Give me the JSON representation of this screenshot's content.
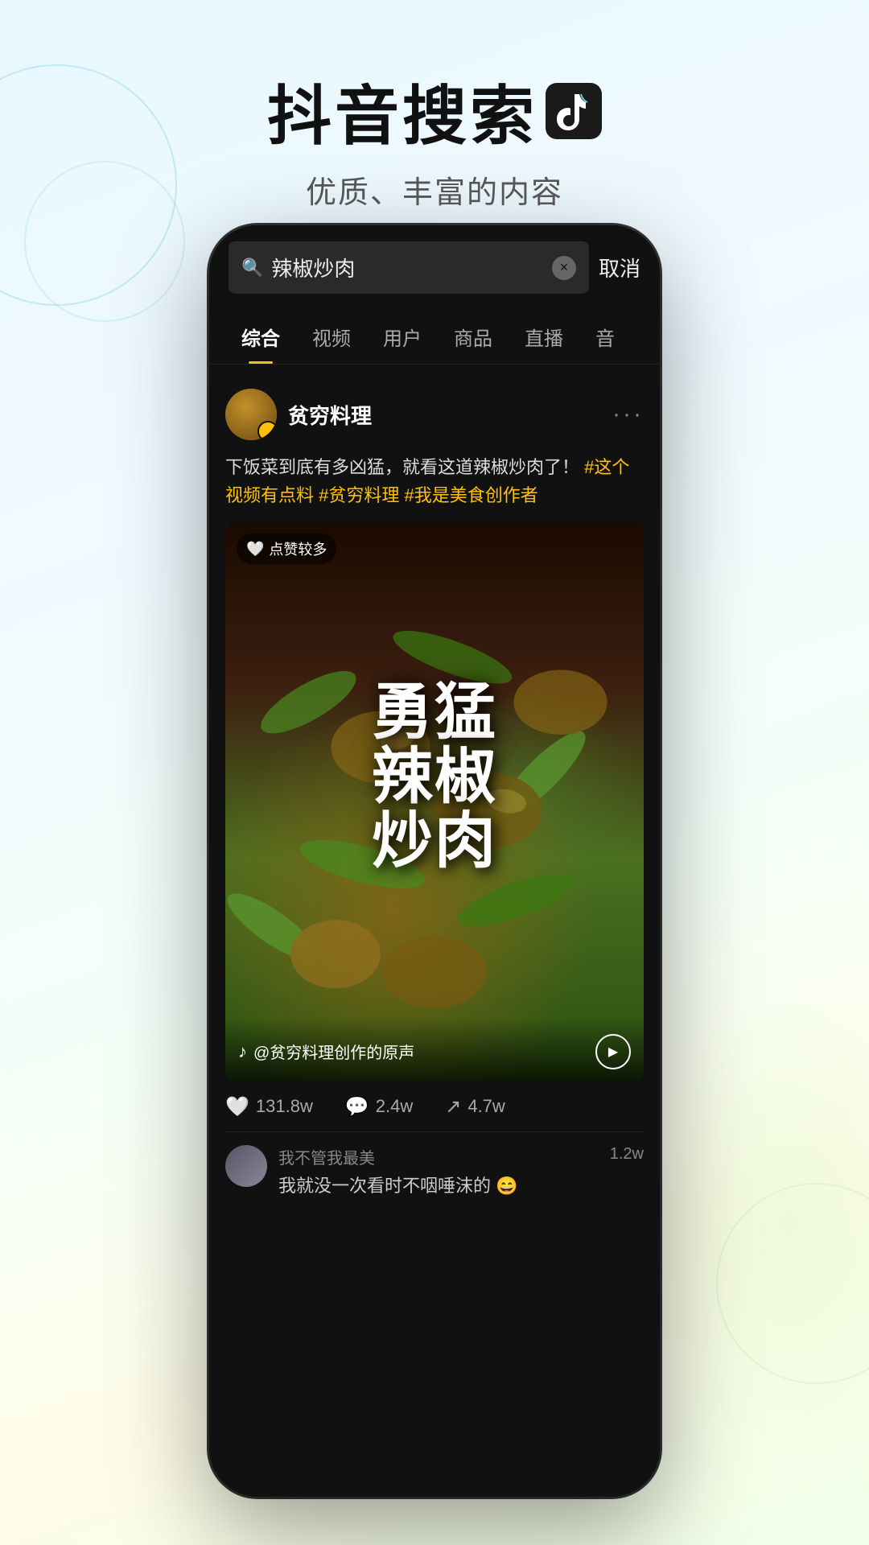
{
  "header": {
    "title": "抖音搜索",
    "tiktok_icon": "♪",
    "subtitle": "优质、丰富的内容"
  },
  "phone": {
    "search_bar": {
      "search_icon": "🔍",
      "query": "辣椒炒肉",
      "clear_icon": "×",
      "cancel_label": "取消"
    },
    "tabs": [
      {
        "label": "综合",
        "active": true
      },
      {
        "label": "视频",
        "active": false
      },
      {
        "label": "用户",
        "active": false
      },
      {
        "label": "商品",
        "active": false
      },
      {
        "label": "直播",
        "active": false
      },
      {
        "label": "音",
        "active": false
      }
    ],
    "post": {
      "user": {
        "username": "贫穷料理",
        "verified": true
      },
      "more_icon": "···",
      "text_main": "下饭菜到底有多凶猛，就看这道辣椒炒肉了！",
      "text_tags": "#这个视频有点料 #贫穷料理 #我是美食创作者",
      "video": {
        "like_badge": "点赞较多",
        "big_text": "勇猛辣椒炒肉",
        "sound_label": "@贫穷料理创作的原声",
        "play_icon": "▶"
      },
      "engagement": {
        "likes": "131.8w",
        "comments": "2.4w",
        "shares": "4.7w"
      },
      "comment": {
        "username": "我不管我最美",
        "text": "我就没一次看时不咽唾沫的 😄",
        "likes": "1.2w"
      }
    }
  }
}
